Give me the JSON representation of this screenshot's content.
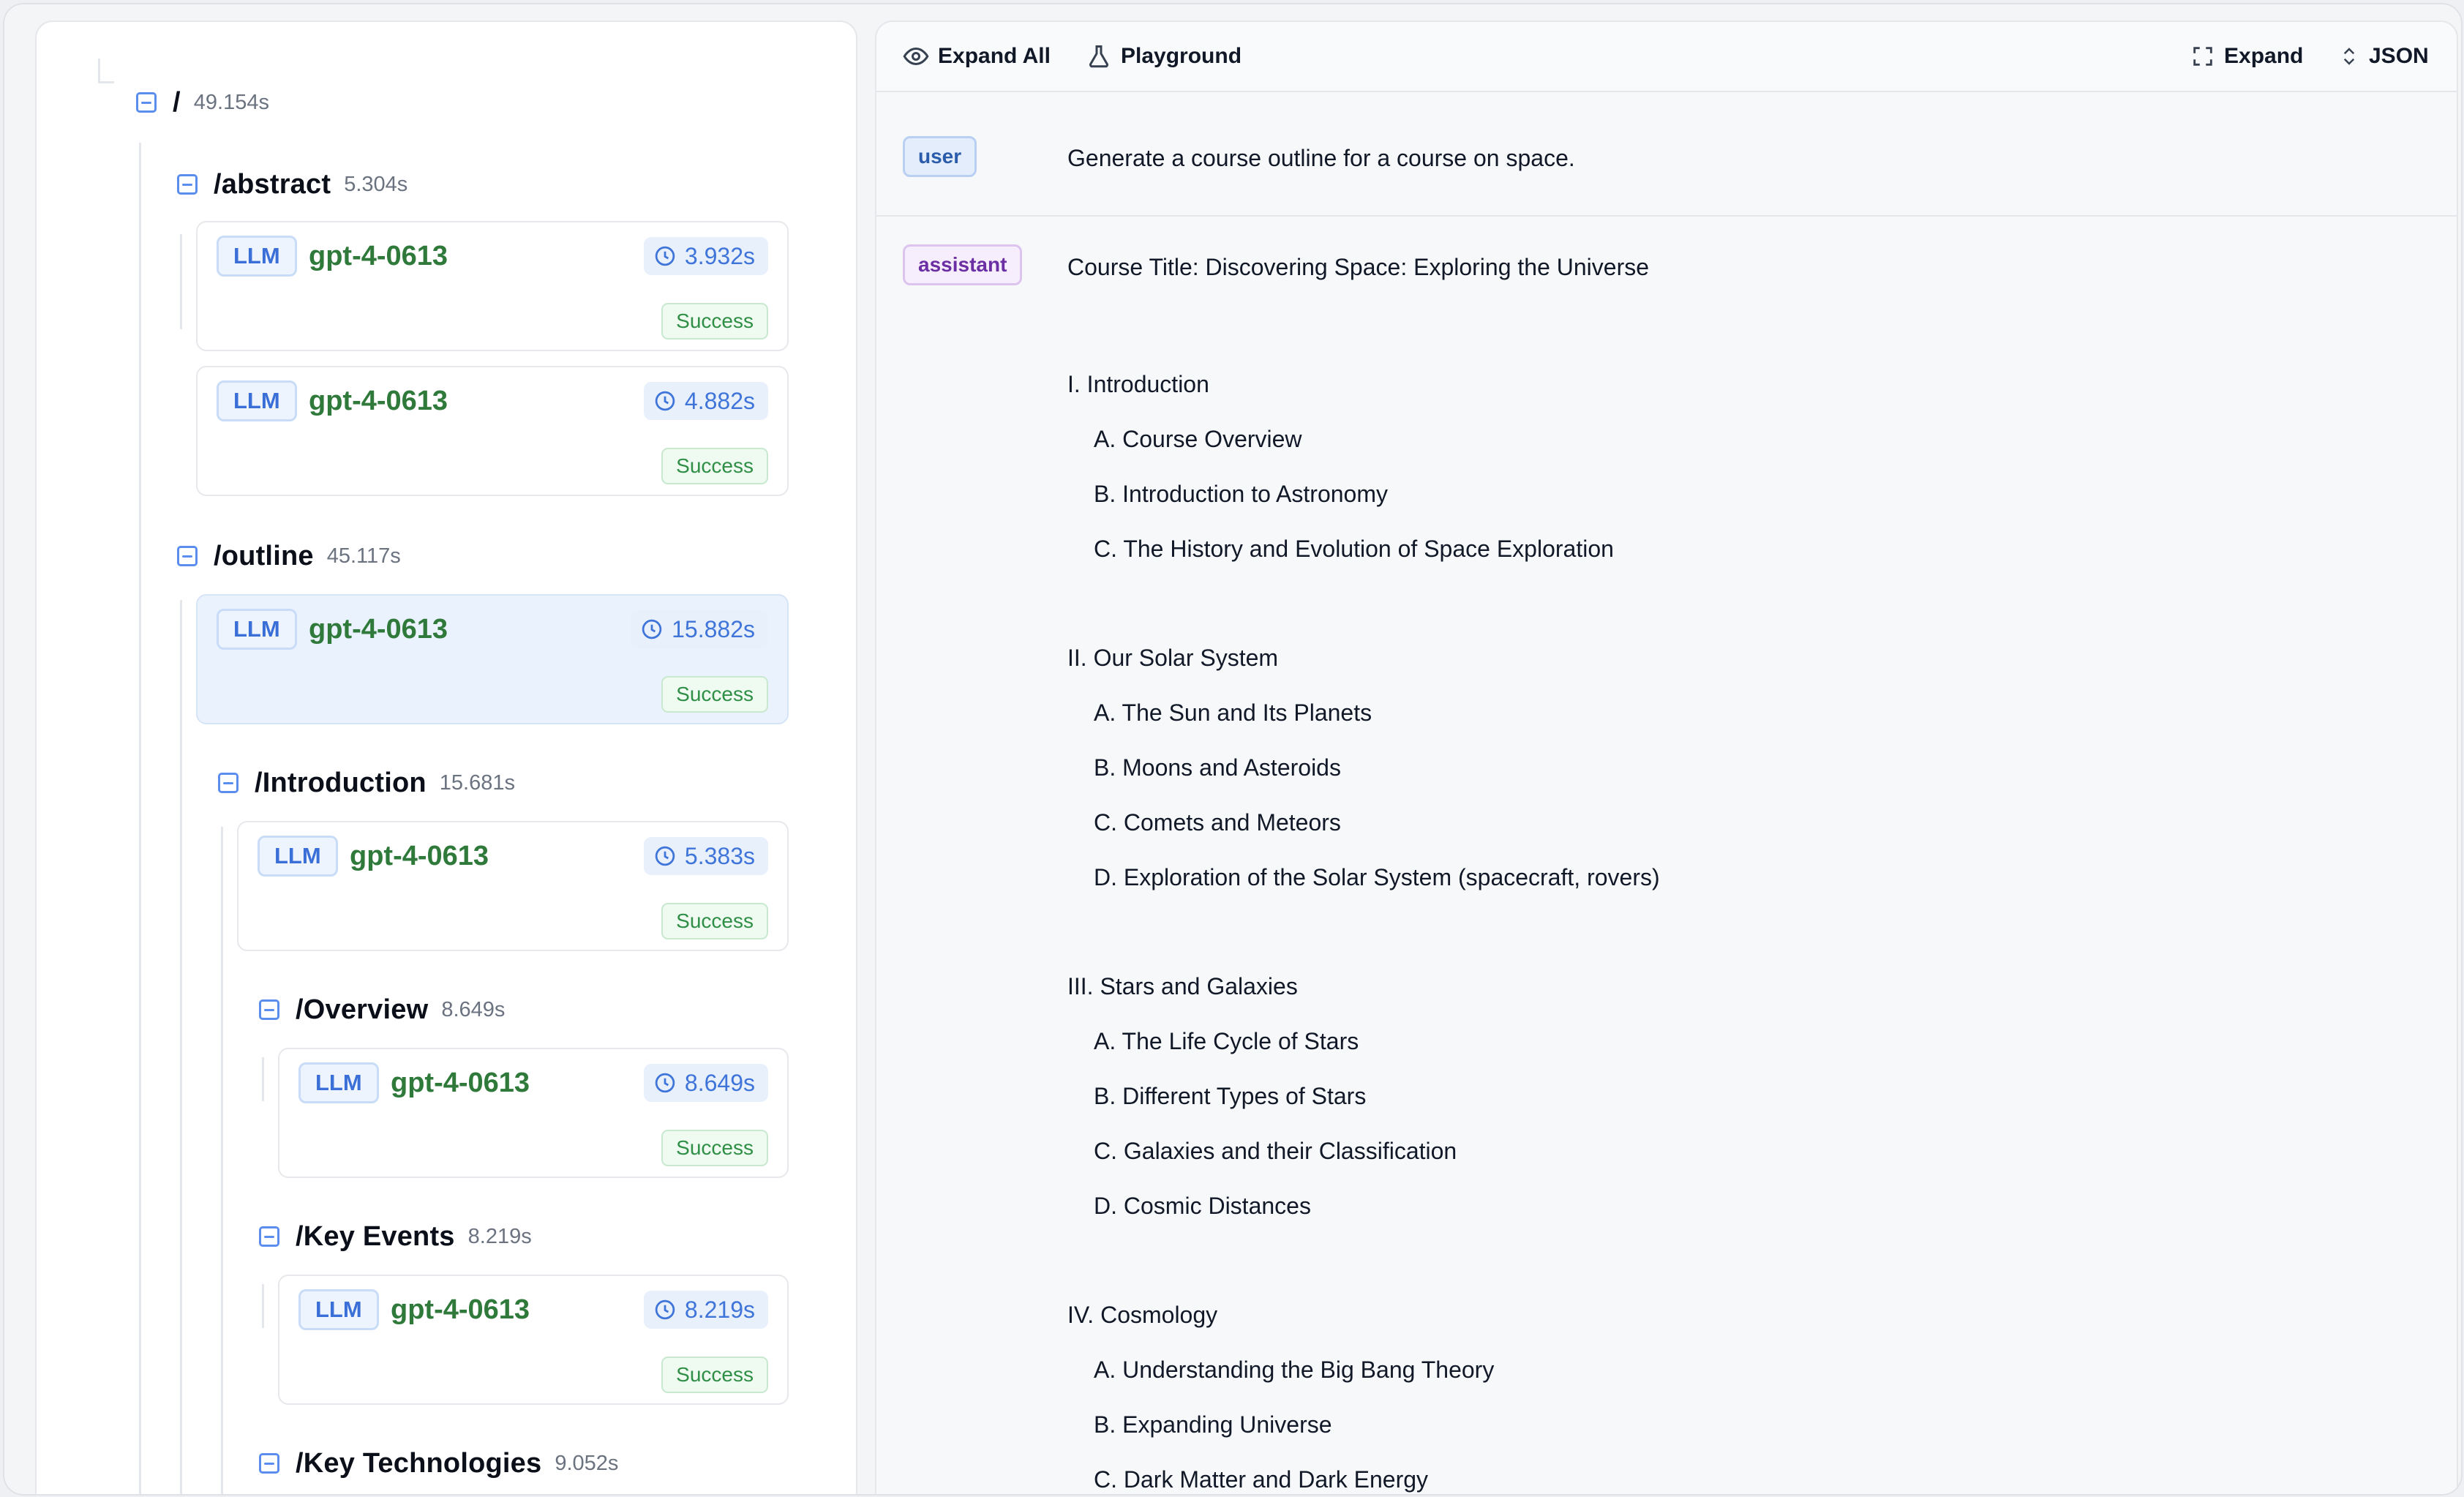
{
  "tree": {
    "root": {
      "name": "/",
      "time": "49.154s"
    },
    "abstract": {
      "name": "/abstract",
      "time": "5.304s",
      "runs": [
        {
          "badge": "LLM",
          "model": "gpt-4-0613",
          "duration": "3.932s",
          "status": "Success"
        },
        {
          "badge": "LLM",
          "model": "gpt-4-0613",
          "duration": "4.882s",
          "status": "Success"
        }
      ]
    },
    "outline": {
      "name": "/outline",
      "time": "45.117s",
      "run": {
        "badge": "LLM",
        "model": "gpt-4-0613",
        "duration": "15.882s",
        "status": "Success"
      }
    },
    "introduction": {
      "name": "/Introduction",
      "time": "15.681s",
      "run": {
        "badge": "LLM",
        "model": "gpt-4-0613",
        "duration": "5.383s",
        "status": "Success"
      }
    },
    "overview": {
      "name": "/Overview",
      "time": "8.649s",
      "run": {
        "badge": "LLM",
        "model": "gpt-4-0613",
        "duration": "8.649s",
        "status": "Success"
      }
    },
    "key_events": {
      "name": "/Key Events",
      "time": "8.219s",
      "run": {
        "badge": "LLM",
        "model": "gpt-4-0613",
        "duration": "8.219s",
        "status": "Success"
      }
    },
    "key_technologies": {
      "name": "/Key Technologies",
      "time": "9.052s"
    }
  },
  "toolbar": {
    "expand_all": "Expand All",
    "playground": "Playground",
    "expand": "Expand",
    "json": "JSON"
  },
  "messages": {
    "user": {
      "role": "user",
      "text": "Generate a course outline for a course on space."
    },
    "assistant": {
      "role": "assistant",
      "title": "Course Title: Discovering Space: Exploring the Universe",
      "sections": [
        {
          "heading": "I. Introduction",
          "items": [
            "A. Course Overview",
            "B. Introduction to Astronomy",
            "C. The History and Evolution of Space Exploration"
          ]
        },
        {
          "heading": "II. Our Solar System",
          "items": [
            "A. The Sun and Its Planets",
            "B. Moons and Asteroids",
            "C. Comets and Meteors",
            "D. Exploration of the Solar System (spacecraft, rovers)"
          ]
        },
        {
          "heading": "III. Stars and Galaxies",
          "items": [
            "A. The Life Cycle of Stars",
            "B. Different Types of Stars",
            "C. Galaxies and their Classification",
            "D. Cosmic Distances"
          ]
        },
        {
          "heading": "IV. Cosmology",
          "items": [
            "A. Understanding the Big Bang Theory",
            "B. Expanding Universe",
            "C. Dark Matter and Dark Energy"
          ]
        }
      ]
    }
  },
  "colors": {
    "accent_blue": "#3f74d9",
    "model_green": "#2f7a3a",
    "success_green": "#2f8f46",
    "assistant_purple": "#6b2fa3"
  }
}
